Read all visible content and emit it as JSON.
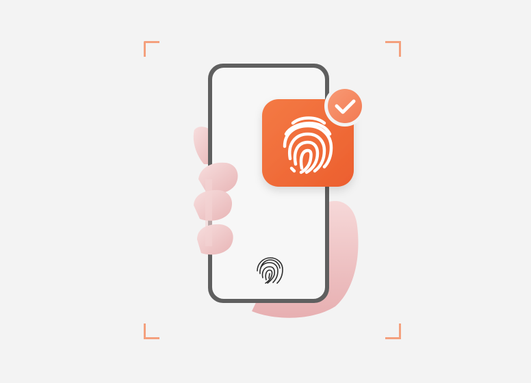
{
  "scene": {
    "icons": {
      "phone": "smartphone-icon",
      "hand": "hand-icon",
      "fingerprint_app": "fingerprint-app-icon",
      "check_badge": "checkmark-badge-icon",
      "screen_fingerprint": "fingerprint-sensor-icon",
      "scan_frame": "scan-frame-corners"
    },
    "colors": {
      "background": "#f3f3f3",
      "accent_orange": "#f26a3a",
      "badge_orange": "#f58a62",
      "frame_corners": "#f4a07d",
      "phone_border": "#5d5d5d",
      "screen": "#f7f7f7",
      "skin": "#f1c9c9"
    }
  }
}
